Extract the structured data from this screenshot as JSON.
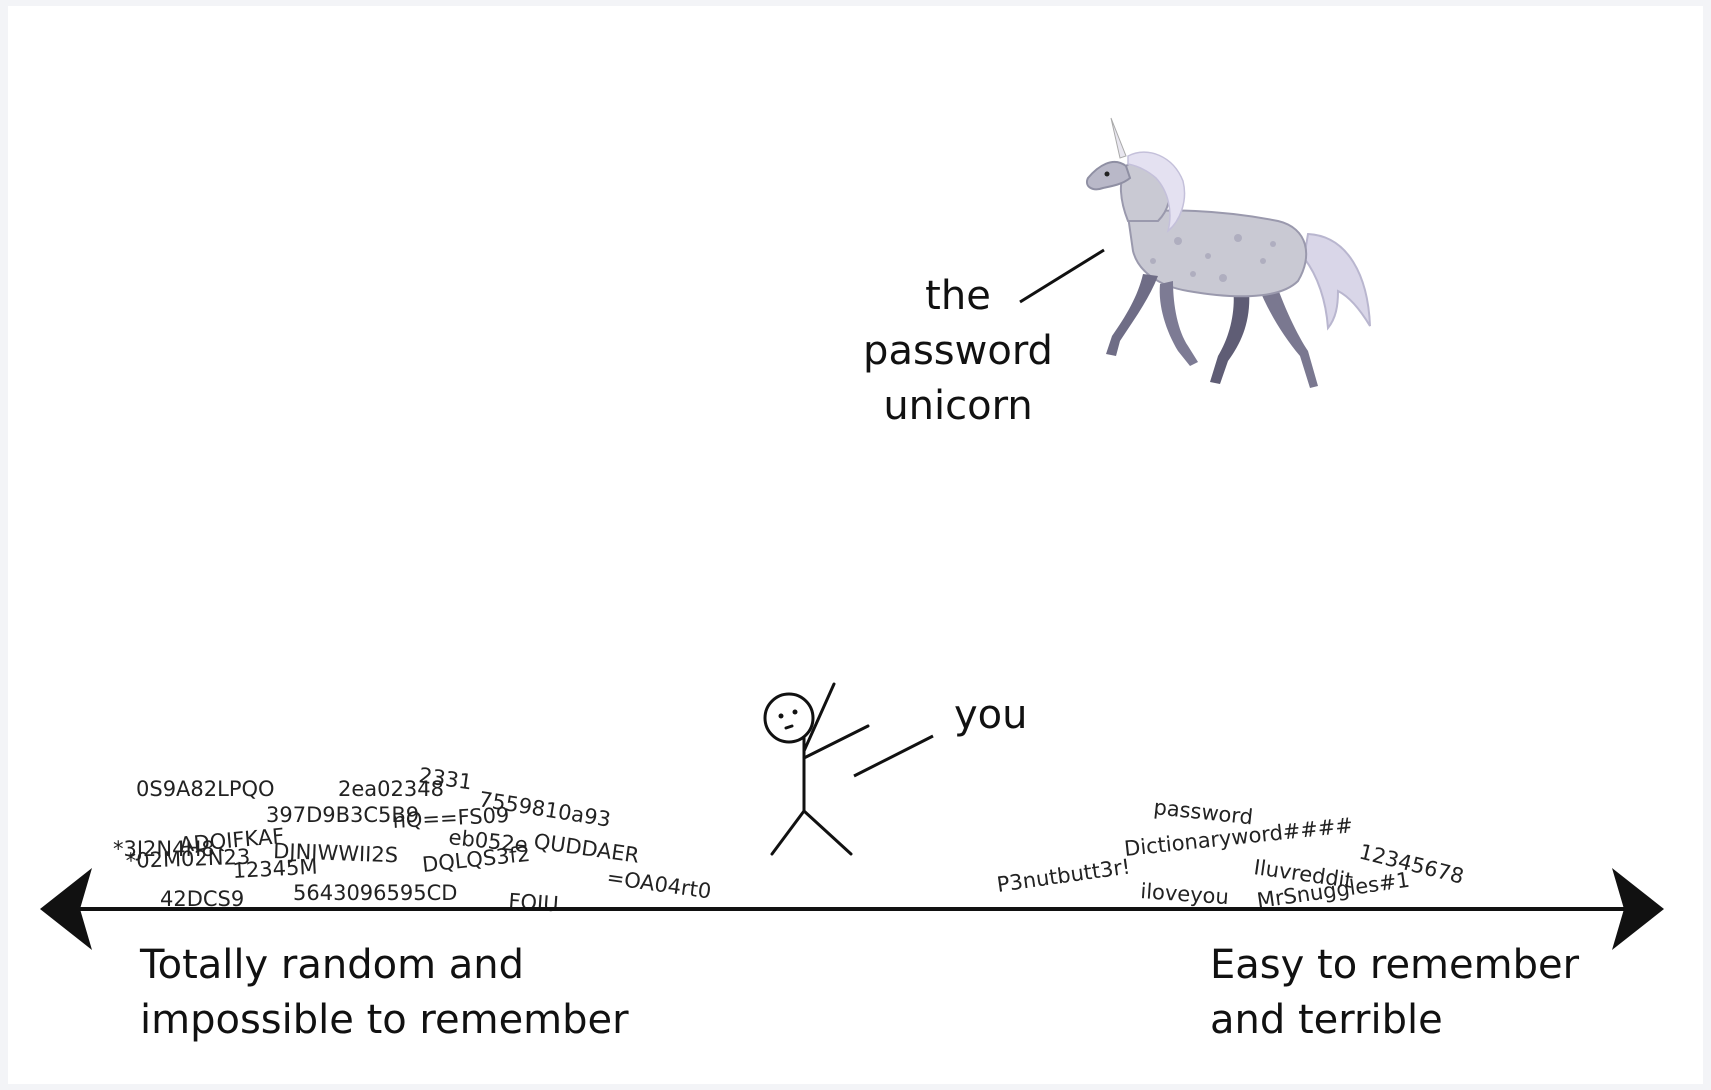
{
  "unicorn_label": {
    "line1": "the",
    "line2": "password",
    "line3": "unicorn"
  },
  "you_label": "you",
  "axis": {
    "left_line1": "Totally random and",
    "left_line2": "impossible to remember",
    "right_line1": "Easy to remember",
    "right_line2": "and terrible"
  },
  "random_passwords": [
    "0S9A82LPQO",
    "2ea02348",
    "2331",
    "397D9B3C5B9",
    "7559810a93",
    "nQ==FS09",
    "*3J2N4H8",
    "ADQIFKAF",
    "DJNIWWII2S",
    "eb052e",
    "QUDDAER",
    "*02M02N23",
    "DQLQS3f2",
    "12345M",
    "=OA04rt0",
    "42DCS9",
    "5643096595CD",
    "FOIU"
  ],
  "weak_passwords": [
    "password",
    "Dictionaryword####",
    "12345678",
    "P3nutbutt3r!",
    "Iluvreddit",
    "iloveyou",
    "MrSnuggles#1"
  ],
  "colors": {
    "ink": "#111111",
    "unicorn_body": "#c9c9d3",
    "unicorn_shadow": "#8f8fa3",
    "page_border": "#f3f4f7"
  }
}
